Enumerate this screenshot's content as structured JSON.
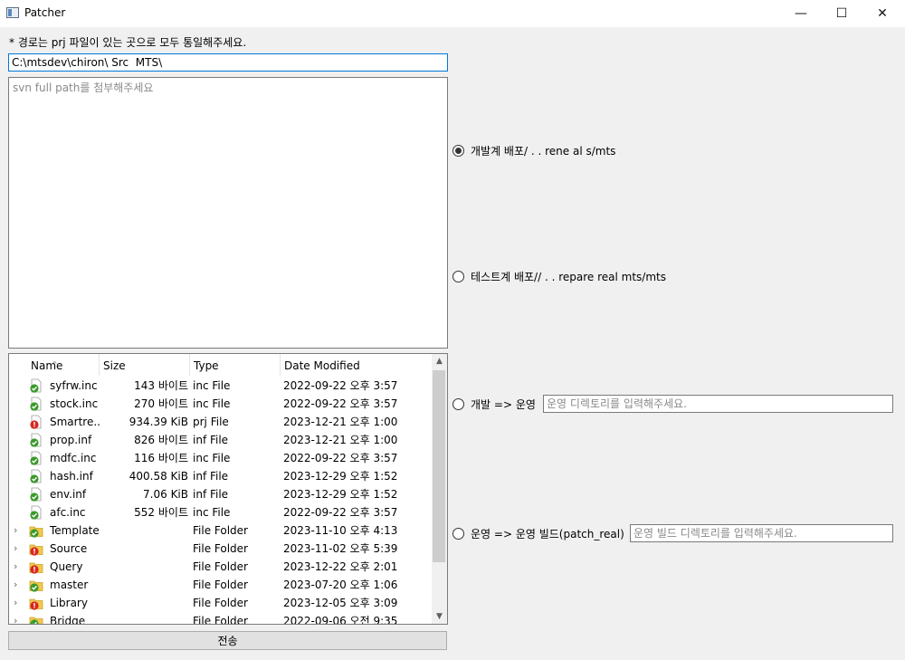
{
  "window": {
    "title": "Patcher",
    "minimize_glyph": "—",
    "maximize_glyph": "☐",
    "close_glyph": "✕"
  },
  "hint": "* 경로는 prj 파일이 있는 곳으로 모두 통일해주세요.",
  "path_input": {
    "value": "C:\\mtsdev\\chiron\\ Src  MTS\\"
  },
  "svn_area": {
    "placeholder": "svn full path를 첨부해주세요"
  },
  "file_list": {
    "columns": {
      "name": "Name",
      "size": "Size",
      "type": "Type",
      "date": "Date Modified"
    },
    "sort_glyph": "^",
    "rows": [
      {
        "expand": "",
        "status": "ok",
        "name": "syfrw.inc",
        "size": "143 바이트",
        "type": "inc File",
        "date": "2022-09-22 오후 3:57"
      },
      {
        "expand": "",
        "status": "ok",
        "name": "stock.inc",
        "size": "270 바이트",
        "type": "inc File",
        "date": "2022-09-22 오후 3:57"
      },
      {
        "expand": "",
        "status": "error",
        "name": "Smartre...",
        "size": "934.39 KiB",
        "type": "prj File",
        "date": "2023-12-21 오후 1:00"
      },
      {
        "expand": "",
        "status": "ok",
        "name": "prop.inf",
        "size": "826 바이트",
        "type": "inf File",
        "date": "2023-12-21 오후 1:00"
      },
      {
        "expand": "",
        "status": "ok",
        "name": "mdfc.inc",
        "size": "116 바이트",
        "type": "inc File",
        "date": "2022-09-22 오후 3:57"
      },
      {
        "expand": "",
        "status": "ok",
        "name": "hash.inf",
        "size": "400.58 KiB",
        "type": "inf File",
        "date": "2023-12-29 오후 1:52"
      },
      {
        "expand": "",
        "status": "ok",
        "name": "env.inf",
        "size": "7.06 KiB",
        "type": "inf File",
        "date": "2023-12-29 오후 1:52"
      },
      {
        "expand": "",
        "status": "ok",
        "name": "afc.inc",
        "size": "552 바이트",
        "type": "inc File",
        "date": "2022-09-22 오후 3:57"
      },
      {
        "expand": "›",
        "status": "folder-ok",
        "name": "Template",
        "size": "",
        "type": "File Folder",
        "date": "2023-11-10 오후 4:13"
      },
      {
        "expand": "›",
        "status": "folder-error",
        "name": "Source",
        "size": "",
        "type": "File Folder",
        "date": "2023-11-02 오후 5:39"
      },
      {
        "expand": "›",
        "status": "folder-error",
        "name": "Query",
        "size": "",
        "type": "File Folder",
        "date": "2023-12-22 오후 2:01"
      },
      {
        "expand": "›",
        "status": "folder-ok",
        "name": "master",
        "size": "",
        "type": "File Folder",
        "date": "2023-07-20 오후 1:06"
      },
      {
        "expand": "›",
        "status": "folder-error",
        "name": "Library",
        "size": "",
        "type": "File Folder",
        "date": "2023-12-05 오후 3:09"
      },
      {
        "expand": "›",
        "status": "folder-ok",
        "name": "Bridge",
        "size": "",
        "type": "File Folder",
        "date": "2022-09-06 오전 9:35"
      }
    ],
    "scroll_up_glyph": "▲",
    "scroll_down_glyph": "▼"
  },
  "send_button": "전송",
  "options": {
    "dev_deploy": "개발계 배포/  . .        rene  al   s/mts",
    "test_deploy": "테스트계 배포//  . .       repare real mts/mts",
    "dev_to_ops": "개발 => 운영",
    "dev_to_ops_placeholder": "운영 디렉토리를 입력해주세요.",
    "ops_to_build": "운영 => 운영 빌드(patch_real)",
    "ops_to_build_placeholder": "운영 빌드 디렉토리를 입력해주세요.",
    "selected": "dev_deploy"
  },
  "colors": {
    "ok": "#3a9a2a",
    "error": "#d8261e",
    "folder": "#f2c94c",
    "focus": "#0078d7"
  }
}
